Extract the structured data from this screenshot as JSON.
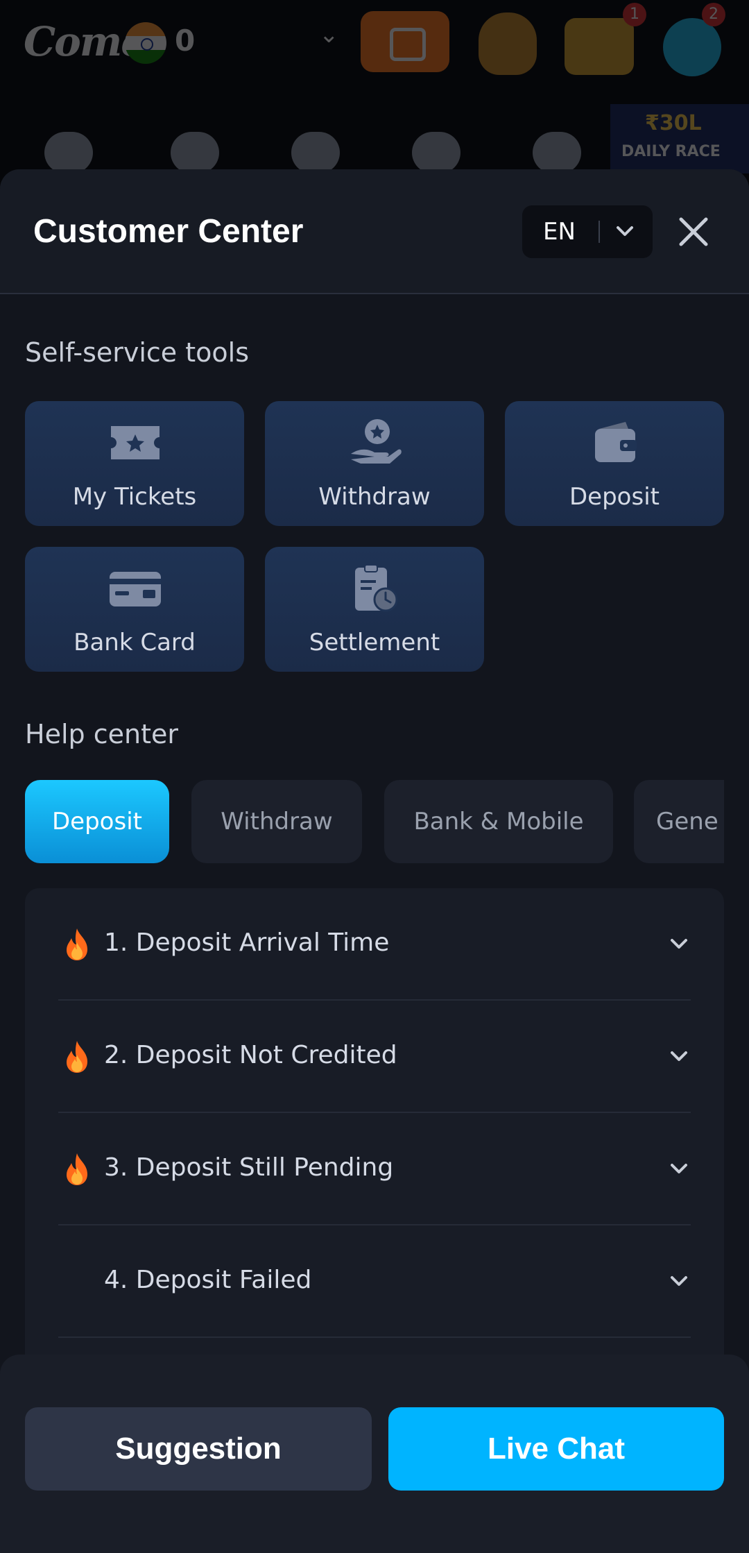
{
  "background": {
    "logo_text": "Come",
    "balance": "0",
    "chest_badge": "1",
    "support_badge": "2",
    "race_amount": "₹30L",
    "race_label": "DAILY RACE"
  },
  "modal": {
    "title": "Customer Center",
    "language": "EN",
    "self_service": {
      "title": "Self-service tools",
      "tools": [
        {
          "label": "My Tickets",
          "icon": "ticket-icon"
        },
        {
          "label": "Withdraw",
          "icon": "withdraw-hand-coin-icon"
        },
        {
          "label": "Deposit",
          "icon": "wallet-icon"
        },
        {
          "label": "Bank Card",
          "icon": "bank-card-icon"
        },
        {
          "label": "Settlement",
          "icon": "clipboard-clock-icon"
        }
      ]
    },
    "help_center": {
      "title": "Help center",
      "tabs": [
        {
          "label": "Deposit",
          "active": true
        },
        {
          "label": "Withdraw",
          "active": false
        },
        {
          "label": "Bank & Mobile",
          "active": false
        },
        {
          "label": "Gene",
          "active": false
        }
      ],
      "faqs": [
        {
          "label": "1. Deposit Arrival Time",
          "hot": true
        },
        {
          "label": "2. Deposit Not Credited",
          "hot": true
        },
        {
          "label": "3. Deposit Still Pending",
          "hot": true
        },
        {
          "label": "4. Deposit Failed",
          "hot": false
        }
      ]
    },
    "footer": {
      "suggestion_label": "Suggestion",
      "live_chat_label": "Live Chat"
    }
  },
  "colors": {
    "accent": "#00b4ff",
    "panel": "#12151d",
    "card": "#1f3354"
  }
}
